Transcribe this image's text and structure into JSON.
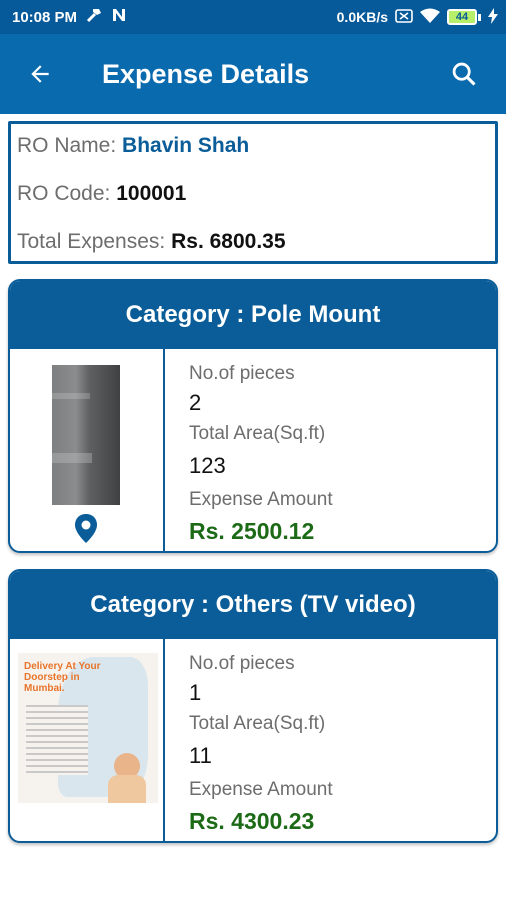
{
  "status_bar": {
    "time": "10:08 PM",
    "speed": "0.0KB/s",
    "battery": "44"
  },
  "app_bar": {
    "title": "Expense Details",
    "back_icon": "arrow-back-icon",
    "search_icon": "search-icon"
  },
  "ro": {
    "name_label": "RO Name: ",
    "name": "Bhavin Shah",
    "code_label": "RO Code: ",
    "code": "100001",
    "total_label": "Total Expenses: ",
    "total": "Rs. 6800.35"
  },
  "categories": [
    {
      "title": "Category : Pole Mount",
      "pieces_label": "No.of pieces",
      "pieces": "2",
      "area_label": "Total Area(Sq.ft)",
      "area": "123",
      "amount_label": "Expense Amount",
      "amount": "Rs. 2500.12"
    },
    {
      "title": "Category : Others (TV video)",
      "pieces_label": "No.of pieces",
      "pieces": "1",
      "area_label": "Total Area(Sq.ft)",
      "area": "11",
      "amount_label": "Expense Amount",
      "amount": "Rs. 4300.23",
      "thumb_headline": "Delivery At Your Doorstep in Mumbai."
    }
  ],
  "colors": {
    "primary": "#0a6aae",
    "status_bar": "#075a9a",
    "amount_green": "#1c6a16"
  }
}
